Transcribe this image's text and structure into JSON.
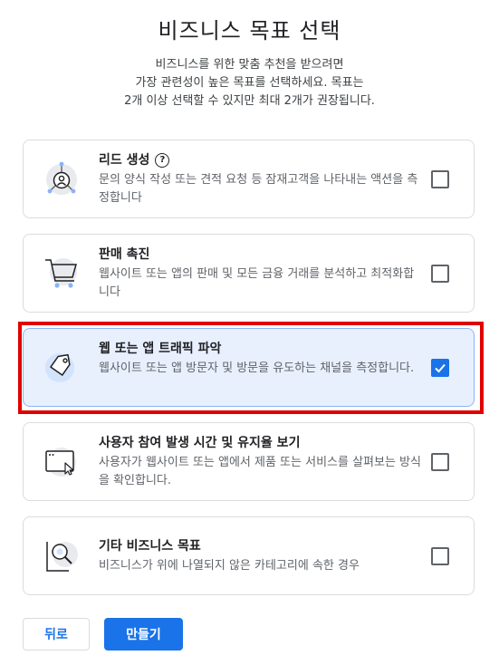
{
  "page": {
    "title": "비즈니스 목표 선택",
    "subtitle": [
      "비즈니스를 위한 맞춤 추천을 받으려면",
      "가장 관련성이 높은 목표를 선택하세요. 목표는",
      "2개 이상 선택할 수 있지만 최대 2개가 권장됩니다."
    ]
  },
  "goals": [
    {
      "title": "리드 생성",
      "has_help": true,
      "description": "문의 양식 작성 또는 견적 요청 등 잠재고객을 나타내는 액션을 측정합니다",
      "icon": "lead-icon",
      "checked": false
    },
    {
      "title": "판매 촉진",
      "has_help": false,
      "description": "웹사이트 또는 앱의 판매 및 모든 금융 거래를 분석하고 최적화합니다",
      "icon": "shopping-cart-icon",
      "checked": false
    },
    {
      "title": "웹 또는 앱 트래픽 파악",
      "has_help": false,
      "description": "웹사이트 또는 앱 방문자 및 방문을 유도하는 채널을 측정합니다.",
      "icon": "tag-icon",
      "checked": true
    },
    {
      "title": "사용자 참여 발생 시간 및 유지율 보기",
      "has_help": false,
      "description": "사용자가 웹사이트 또는 앱에서 제품 또는 서비스를 살펴보는 방식을 확인합니다.",
      "icon": "browser-window-icon",
      "checked": false
    },
    {
      "title": "기타 비즈니스 목표",
      "has_help": false,
      "description": "비즈니스가 위에 나열되지 않은 카테고리에 속한 경우",
      "icon": "magnifier-icon",
      "checked": false
    }
  ],
  "help_glyph": "?",
  "buttons": {
    "back_label": "뒤로",
    "create_label": "만들기"
  },
  "colors": {
    "accent": "#1a73e8",
    "selected_bg": "#e8f0fe",
    "highlight_frame": "#e00000"
  }
}
